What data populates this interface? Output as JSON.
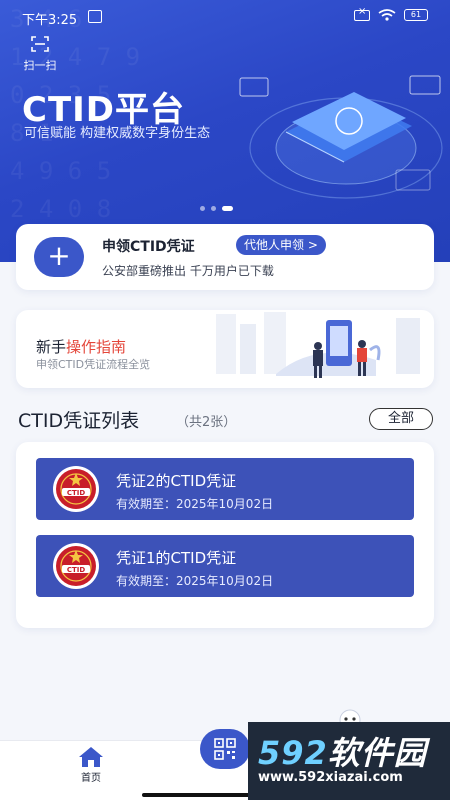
{
  "status_bar": {
    "time": "下午3:25",
    "battery": "61"
  },
  "hero": {
    "scan_label": "扫一扫",
    "title": "CTID平台",
    "subtitle": "可信赋能 构建权威数字身份生态",
    "bg_digits": [
      "3 4 6",
      "1 2 4 7 9",
      "0 2 3 5",
      "8 1",
      "4 9 6 5",
      "2 4 0 8"
    ],
    "carousel": {
      "total": 3,
      "active_index": 2
    }
  },
  "apply_card": {
    "title": "申领CTID凭证",
    "agent_tag": "代他人申领 >",
    "description": "公安部重磅推出 千万用户已下载"
  },
  "guide_card": {
    "title_prefix": "新手",
    "title_highlight": "操作指南",
    "description": "申领CTID凭证流程全览"
  },
  "credential_list": {
    "title": "CTID凭证列表",
    "count": "（共2张）",
    "all_button": "全部",
    "items": [
      {
        "name": "凭证2的CTID凭证",
        "validity": "有效期至：2025年10月02日",
        "seal_text": "CTID"
      },
      {
        "name": "凭证1的CTID凭证",
        "validity": "有效期至：2025年10月02日",
        "seal_text": "CTID"
      }
    ]
  },
  "tabbar": {
    "home_label": "首页"
  },
  "watermark": {
    "brand_number": "592",
    "brand_text": "软件园",
    "url": "www.592xiazai.com"
  },
  "colors": {
    "primary": "#3b57c9",
    "hero": "#2b47c6",
    "accent_red": "#e4463a",
    "seal_red": "#c81e2a"
  }
}
